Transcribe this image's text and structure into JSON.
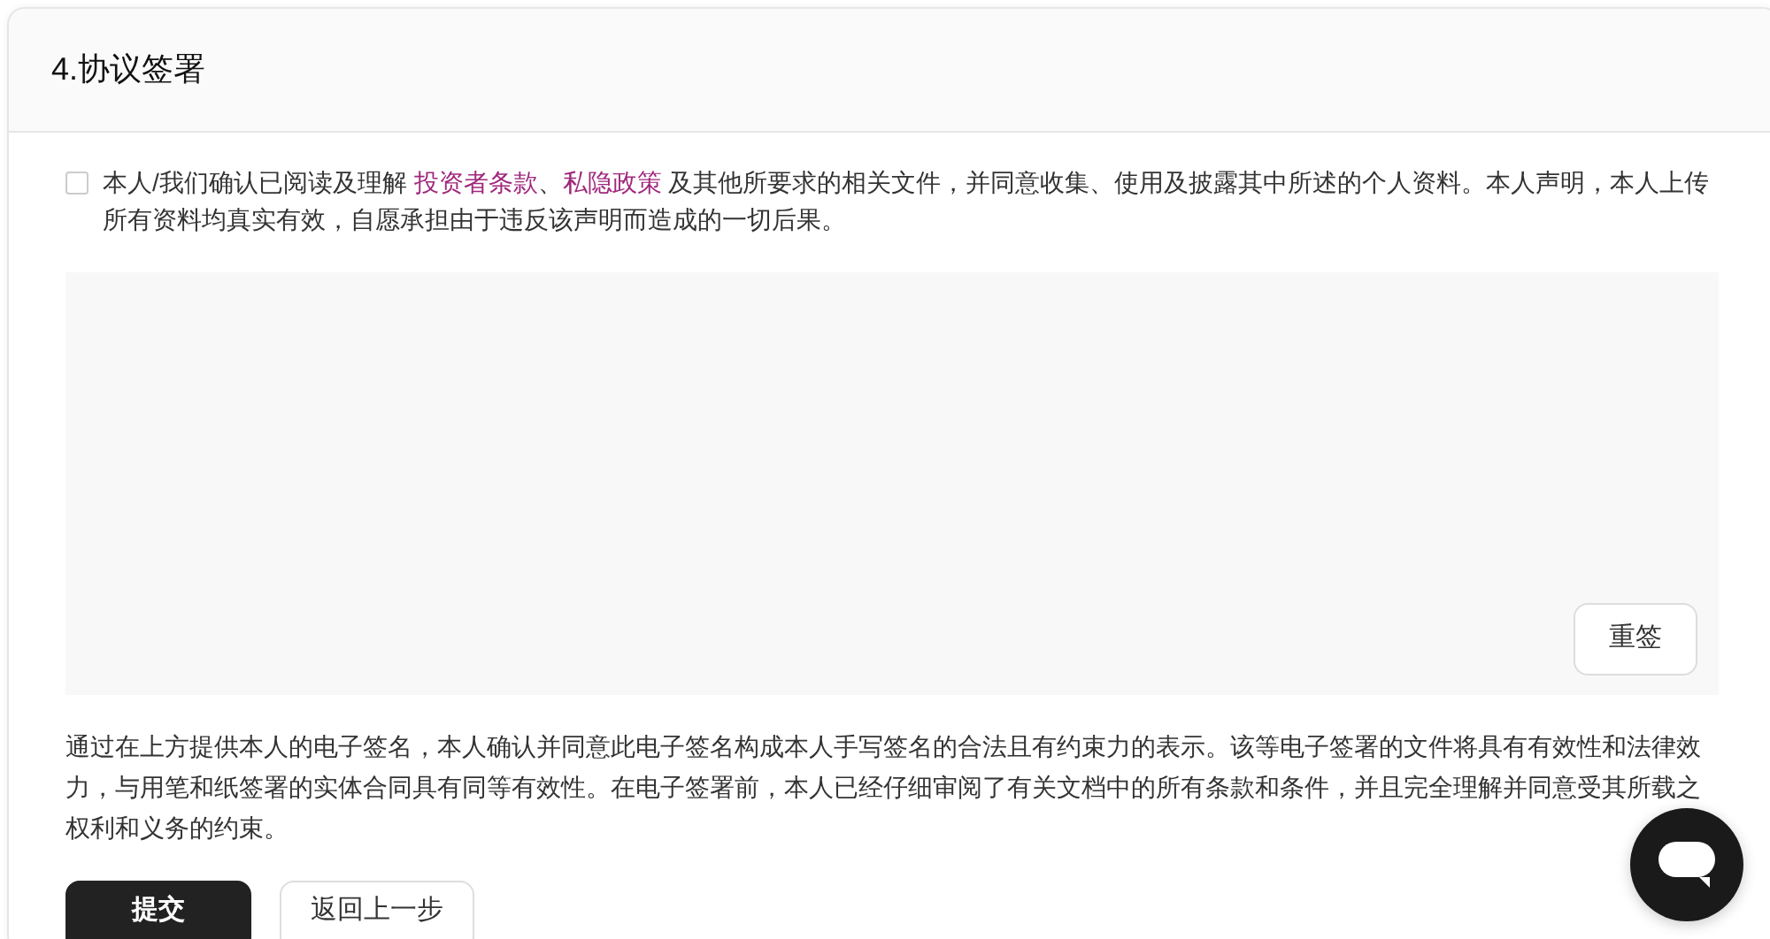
{
  "section": {
    "title": "4.协议签署"
  },
  "consent": {
    "checked": false,
    "text_before": "本人/我们确认已阅读及理解 ",
    "links": [
      "投资者条款",
      "私隐政策"
    ],
    "link_separator": "、",
    "text_after": " 及其他所要求的相关文件，并同意收集、使用及披露其中所述的个人资料。本人声明，本人上传所有资料均真实有效，自愿承担由于违反该声明而造成的一切后果。"
  },
  "signature_pad": {
    "reset_button": "重签"
  },
  "statement": "通过在上方提供本人的电子签名，本人确认并同意此电子签名构成本人手写签名的合法且有约束力的表示。该等电子签署的文件将具有有效性和法律效力，与用笔和纸签署的实体合同具有同等有效性。在电子签署前，本人已经仔细审阅了有关文档中的所有条款和条件，并且完全理解并同意受其所载之权利和义务的约束。",
  "buttons": [
    {
      "label": "提交",
      "kind": "primary"
    },
    {
      "label": "返回上一步",
      "kind": "secondary"
    }
  ]
}
